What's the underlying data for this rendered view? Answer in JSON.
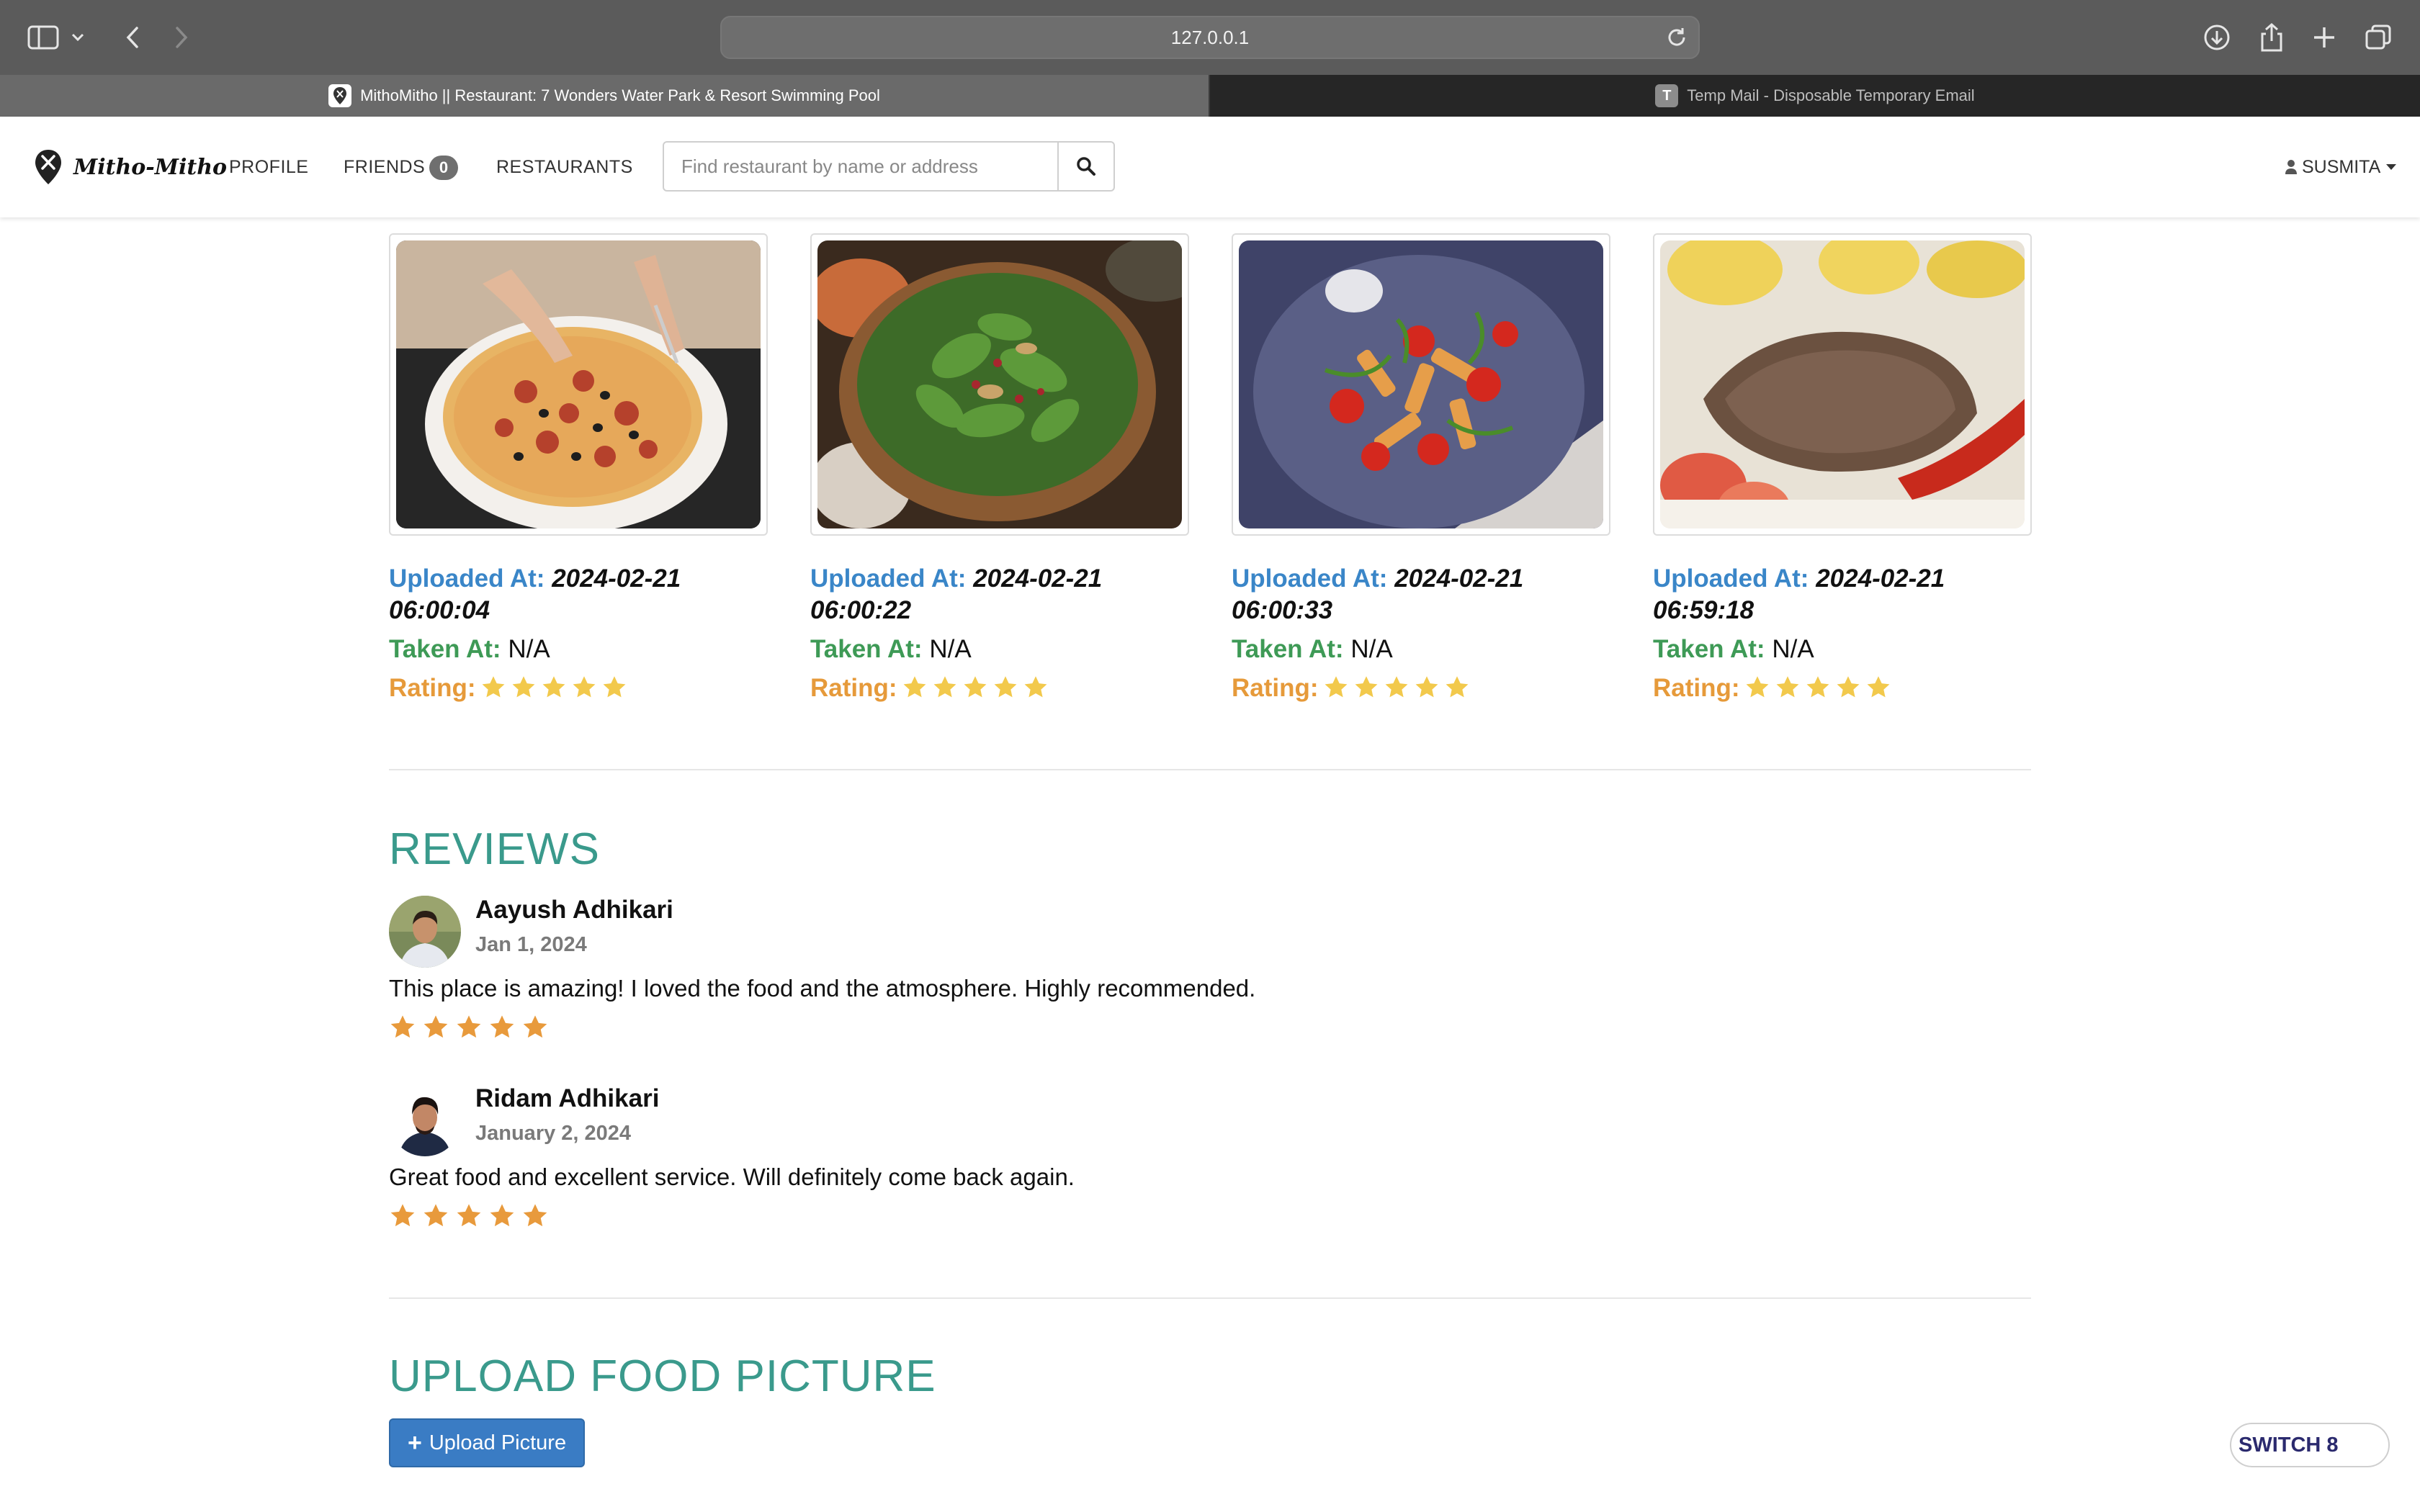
{
  "browser": {
    "url": "127.0.0.1",
    "tabs": [
      {
        "label": "MithoMitho || Restaurant: 7 Wonders Water Park & Resort Swimming Pool",
        "active": true
      },
      {
        "label": "Temp Mail - Disposable Temporary Email",
        "favicon": "T",
        "active": false
      }
    ]
  },
  "navbar": {
    "brand": "Mitho-Mitho",
    "profile": "PROFILE",
    "friends": "FRIENDS",
    "friends_count": "0",
    "restaurants": "RESTAURANTS",
    "search_placeholder": "Find restaurant by name or address",
    "user": "SUSMITA"
  },
  "photos": [
    {
      "subject": "pizza",
      "uploaded_label": "Uploaded At:",
      "uploaded_date": "2024-02-21",
      "uploaded_time": "06:00:04",
      "taken_label": "Taken At:",
      "taken_value": "N/A",
      "rating_label": "Rating:",
      "rating": 5
    },
    {
      "subject": "salad",
      "uploaded_label": "Uploaded At:",
      "uploaded_date": "2024-02-21",
      "uploaded_time": "06:00:22",
      "taken_label": "Taken At:",
      "taken_value": "N/A",
      "rating_label": "Rating:",
      "rating": 5
    },
    {
      "subject": "pasta",
      "uploaded_label": "Uploaded At:",
      "uploaded_date": "2024-02-21",
      "uploaded_time": "06:00:33",
      "taken_label": "Taken At:",
      "taken_value": "N/A",
      "rating_label": "Rating:",
      "rating": 5
    },
    {
      "subject": "steak",
      "uploaded_label": "Uploaded At:",
      "uploaded_date": "2024-02-21",
      "uploaded_time": "06:59:18",
      "taken_label": "Taken At:",
      "taken_value": "N/A",
      "rating_label": "Rating:",
      "rating": 5
    }
  ],
  "reviews": {
    "title": "REVIEWS",
    "items": [
      {
        "name": "Aayush Adhikari",
        "date": "Jan 1, 2024",
        "text": "This place is amazing! I loved the food and the atmosphere. Highly recommended.",
        "rating": 5
      },
      {
        "name": "Ridam Adhikari",
        "date": "January 2, 2024",
        "text": "Great food and excellent service. Will definitely come back again.",
        "rating": 5
      }
    ]
  },
  "upload": {
    "title": "UPLOAD FOOD PICTURE",
    "button": "Upload Picture"
  },
  "switch_label": "SWITCH 8",
  "colors": {
    "uploaded": "#3a86c8",
    "taken": "#3e9a56",
    "rating": "#e69a3a",
    "photo_star": "#f2c94c",
    "review_star": "#e89a3c",
    "section_title": "#3a9a8c",
    "upload_button": "#3a7cc4"
  }
}
